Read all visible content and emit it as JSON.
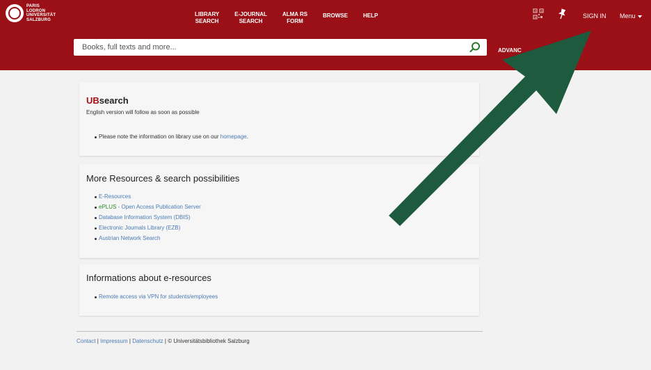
{
  "header": {
    "logo_lines": [
      "PARIS",
      "LODRON",
      "UNIVERSITÄT",
      "SALZBURG"
    ],
    "nav": [
      {
        "line1": "LIBRARY",
        "line2": "SEARCH"
      },
      {
        "line1": "E-JOURNAL",
        "line2": "SEARCH"
      },
      {
        "line1": "ALMA RS",
        "line2": "FORM"
      },
      {
        "line1": "BROWSE",
        "line2": ""
      },
      {
        "line1": "HELP",
        "line2": ""
      }
    ],
    "sign_in": "SIGN IN",
    "menu": "Menu",
    "icons": [
      "qr-code-icon",
      "pin-icon",
      "chevron-down-icon"
    ]
  },
  "search": {
    "placeholder": "Books, full texts and more...",
    "advanced": "ADVANC"
  },
  "card1": {
    "title_prefix": "UB",
    "title_suffix": "search",
    "subtitle": "English version will follow as soon as possible",
    "note_text": "Please note the information on library use on our ",
    "note_link": "homepage",
    "note_end": "."
  },
  "card2": {
    "title": "More Resources & search possibilities",
    "items": [
      {
        "prefix": "",
        "label": "E-Resources"
      },
      {
        "prefix": "ePLUS",
        "label": " - Open Access Publication Server"
      },
      {
        "prefix": "",
        "label": "Database Information System (DBIS)"
      },
      {
        "prefix": "",
        "label": "Electronic Journals Library (EZB)"
      },
      {
        "prefix": "",
        "label": "Austrian Network Search"
      }
    ]
  },
  "card3": {
    "title": "Informations about e-resources",
    "item": "Remote access via VPN for students/employees"
  },
  "footer": {
    "contact": "Contact",
    "impressum": "Impressum",
    "datenschutz": "Datenschutz",
    "sep": " | ",
    "copyright": "© Universitätsbibliothek Salzburg"
  },
  "colors": {
    "header_red": "#9b1016",
    "link_blue": "#4a7bb5",
    "arrow_green": "#1e5a3e",
    "eplus_green": "#2a8a2a"
  }
}
